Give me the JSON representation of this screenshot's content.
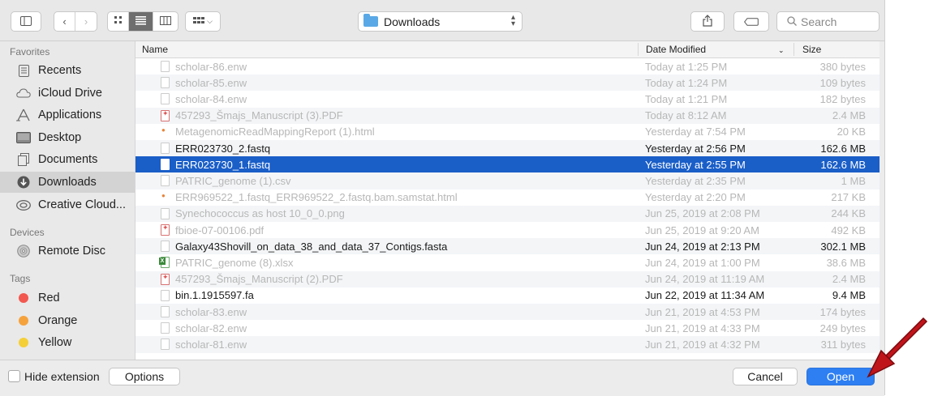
{
  "toolbar": {
    "location": "Downloads",
    "search_placeholder": "Search"
  },
  "sidebar": {
    "favorites_heading": "Favorites",
    "favorites": [
      {
        "label": "Recents",
        "icon": "recents-icon"
      },
      {
        "label": "iCloud Drive",
        "icon": "cloud-icon"
      },
      {
        "label": "Applications",
        "icon": "applications-icon"
      },
      {
        "label": "Desktop",
        "icon": "desktop-icon"
      },
      {
        "label": "Documents",
        "icon": "documents-icon"
      },
      {
        "label": "Downloads",
        "icon": "downloads-icon"
      },
      {
        "label": "Creative Cloud...",
        "icon": "creative-cloud-icon"
      }
    ],
    "devices_heading": "Devices",
    "devices": [
      {
        "label": "Remote Disc",
        "icon": "disc-icon"
      }
    ],
    "tags_heading": "Tags",
    "tags": [
      {
        "label": "Red",
        "color": "#f2584f"
      },
      {
        "label": "Orange",
        "color": "#f6a23c"
      },
      {
        "label": "Yellow",
        "color": "#f5cf37"
      }
    ]
  },
  "columns": {
    "name": "Name",
    "date": "Date Modified",
    "size": "Size"
  },
  "files": [
    {
      "name": "scholar-86.enw",
      "date": "Today at 1:25 PM",
      "size": "380 bytes",
      "type": "doc",
      "enabled": false
    },
    {
      "name": "scholar-85.enw",
      "date": "Today at 1:24 PM",
      "size": "109 bytes",
      "type": "doc",
      "enabled": false
    },
    {
      "name": "scholar-84.enw",
      "date": "Today at 1:21 PM",
      "size": "182 bytes",
      "type": "doc",
      "enabled": false
    },
    {
      "name": "457293_Šmajs_Manuscript (3).PDF",
      "date": "Today at 8:12 AM",
      "size": "2.4 MB",
      "type": "pdf",
      "enabled": false
    },
    {
      "name": "MetagenomicReadMappingReport (1).html",
      "date": "Yesterday at 7:54 PM",
      "size": "20 KB",
      "type": "html",
      "enabled": false
    },
    {
      "name": "ERR023730_2.fastq",
      "date": "Yesterday at 2:56 PM",
      "size": "162.6 MB",
      "type": "doc",
      "enabled": true
    },
    {
      "name": "ERR023730_1.fastq",
      "date": "Yesterday at 2:55 PM",
      "size": "162.6 MB",
      "type": "doc",
      "enabled": true,
      "selected": true
    },
    {
      "name": "PATRIC_genome (1).csv",
      "date": "Yesterday at 2:35 PM",
      "size": "1 MB",
      "type": "doc",
      "enabled": false
    },
    {
      "name": "ERR969522_1.fastq_ERR969522_2.fastq.bam.samstat.html",
      "date": "Yesterday at 2:20 PM",
      "size": "217 KB",
      "type": "html",
      "enabled": false
    },
    {
      "name": "Synechococcus as host 10_0_0.png",
      "date": "Jun 25, 2019 at 2:08 PM",
      "size": "244 KB",
      "type": "doc",
      "enabled": false
    },
    {
      "name": "fbioe-07-00106.pdf",
      "date": "Jun 25, 2019 at 9:20 AM",
      "size": "492 KB",
      "type": "pdf",
      "enabled": false
    },
    {
      "name": "Galaxy43Shovill_on_data_38_and_data_37_Contigs.fasta",
      "date": "Jun 24, 2019 at 2:13 PM",
      "size": "302.1 MB",
      "type": "doc",
      "enabled": true
    },
    {
      "name": "PATRIC_genome (8).xlsx",
      "date": "Jun 24, 2019 at 1:00 PM",
      "size": "38.6 MB",
      "type": "xlsx",
      "enabled": false
    },
    {
      "name": "457293_Šmajs_Manuscript (2).PDF",
      "date": "Jun 24, 2019 at 11:19 AM",
      "size": "2.4 MB",
      "type": "pdf",
      "enabled": false
    },
    {
      "name": "bin.1.1915597.fa",
      "date": "Jun 22, 2019 at 11:34 AM",
      "size": "9.4 MB",
      "type": "doc",
      "enabled": true
    },
    {
      "name": "scholar-83.enw",
      "date": "Jun 21, 2019 at 4:53 PM",
      "size": "174 bytes",
      "type": "doc",
      "enabled": false
    },
    {
      "name": "scholar-82.enw",
      "date": "Jun 21, 2019 at 4:33 PM",
      "size": "249 bytes",
      "type": "doc",
      "enabled": false
    },
    {
      "name": "scholar-81.enw",
      "date": "Jun 21, 2019 at 4:32 PM",
      "size": "311 bytes",
      "type": "doc",
      "enabled": false
    }
  ],
  "bottom": {
    "hide_extension_label": "Hide extension",
    "options_label": "Options",
    "cancel_label": "Cancel",
    "open_label": "Open"
  },
  "annotation": {
    "arrow_color": "#c0141b"
  }
}
